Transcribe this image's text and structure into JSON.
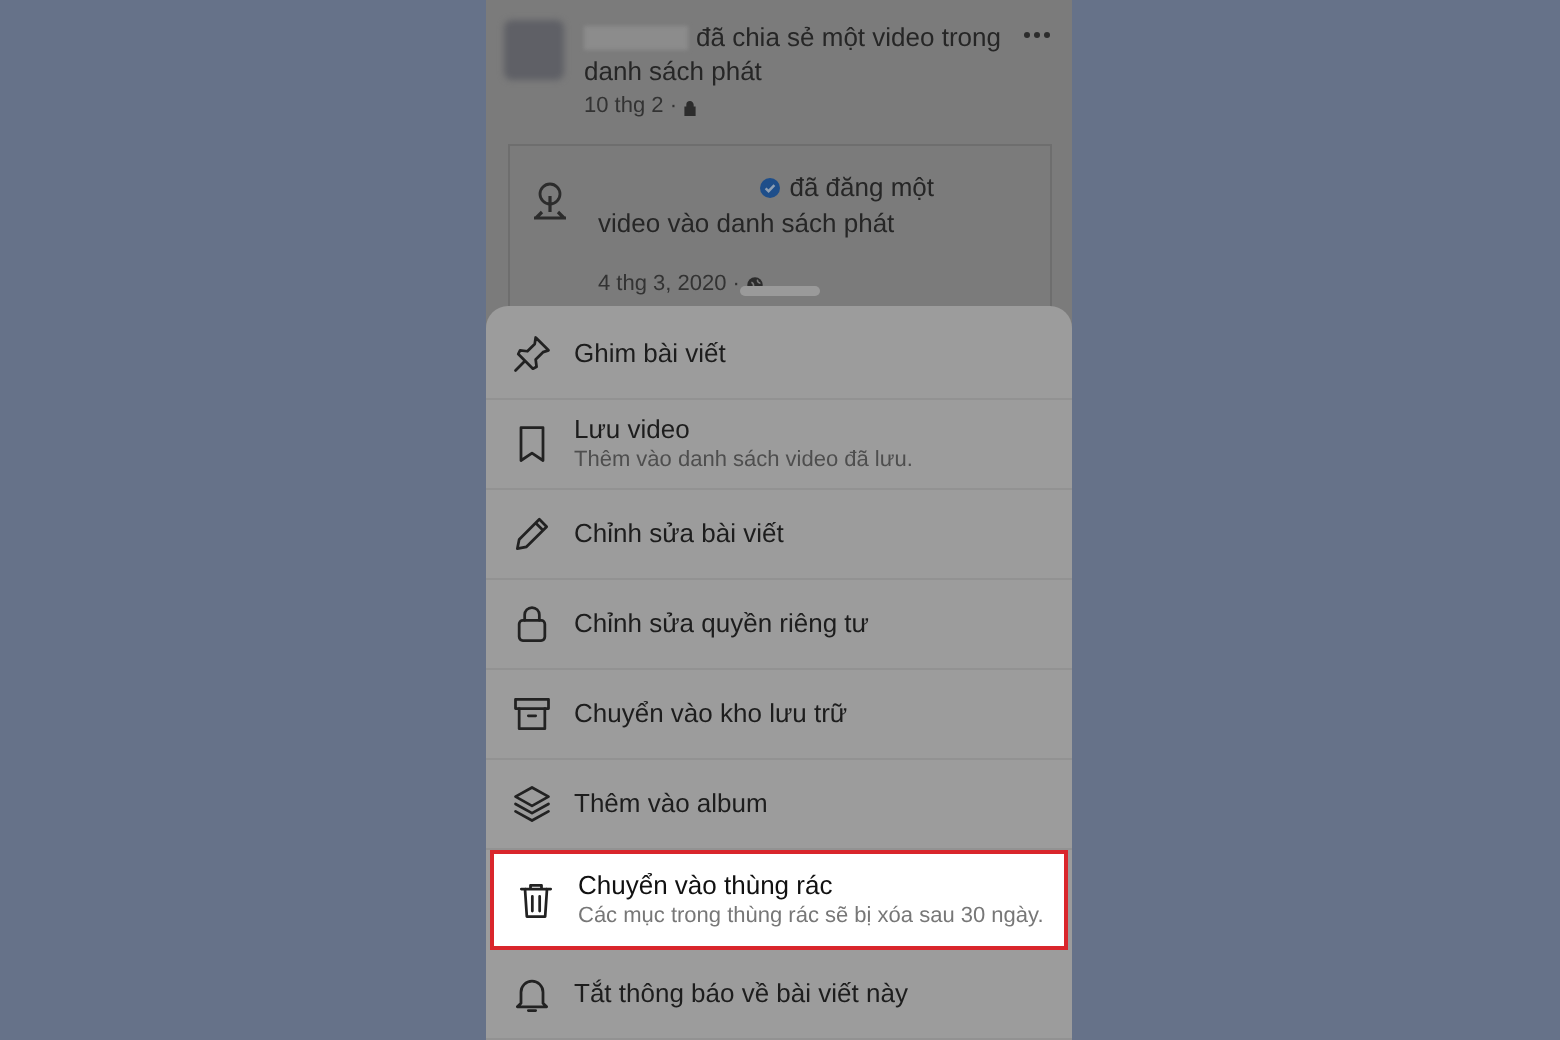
{
  "post": {
    "action": "đã chia sẻ một video trong",
    "action_line2": "danh sách phát",
    "date": "10 thg 2 ·",
    "shared": {
      "action": "đã đăng một",
      "action_line2": "video vào danh sách phát",
      "date": "4 thg 3, 2020 ·"
    }
  },
  "sheet": {
    "items": [
      {
        "kind": "pin",
        "title": "Ghim bài viết",
        "selected": false
      },
      {
        "kind": "bookmark",
        "title": "Lưu video",
        "subtitle": "Thêm vào danh sách video đã lưu.",
        "selected": false
      },
      {
        "kind": "pencil",
        "title": "Chỉnh sửa bài viết",
        "selected": false
      },
      {
        "kind": "lock",
        "title": "Chỉnh sửa quyền riêng tư",
        "selected": false
      },
      {
        "kind": "archive",
        "title": "Chuyển vào kho lưu trữ",
        "selected": false
      },
      {
        "kind": "layers",
        "title": "Thêm vào album",
        "selected": false
      },
      {
        "kind": "trash",
        "title": "Chuyển vào thùng rác",
        "subtitle": "Các mục trong thùng rác sẽ bị xóa sau 30 ngày.",
        "selected": true
      },
      {
        "kind": "bell",
        "title": "Tắt thông báo về bài viết này",
        "selected": false
      }
    ]
  }
}
